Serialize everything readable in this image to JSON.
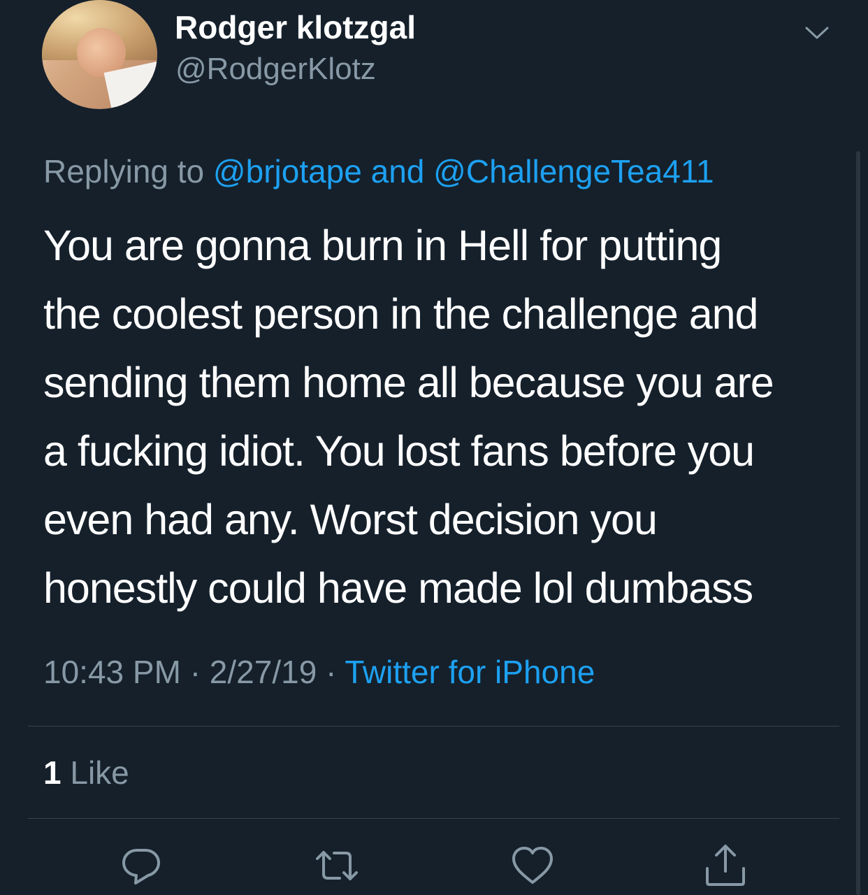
{
  "tweet": {
    "display_name": "Rodger klotzgal",
    "handle": "@RodgerKlotz",
    "replying_prefix": "Replying to",
    "reply_to_1": "@brjotape",
    "reply_and": "and",
    "reply_to_2": "@ChallengeTea411",
    "body_lines": [
      "You are gonna burn in Hell for putting",
      "the coolest person in the challenge and",
      "sending them home all because you are",
      "a fucking idiot. You lost fans before you",
      "even had any. Worst decision you",
      "honestly could have made lol dumbass"
    ],
    "time": "10:43 PM",
    "separator": "·",
    "date": "2/27/19",
    "source": "Twitter for iPhone",
    "like_count": "1",
    "like_label": "Like"
  },
  "icons": {
    "menu": "chevron-down-icon",
    "reply": "reply-icon",
    "retweet": "retweet-icon",
    "like": "heart-icon",
    "share": "share-icon"
  },
  "colors": {
    "background": "#15202b",
    "text_primary": "#ffffff",
    "text_secondary": "#8899a6",
    "link": "#1da1f2",
    "divider": "#38444d"
  }
}
